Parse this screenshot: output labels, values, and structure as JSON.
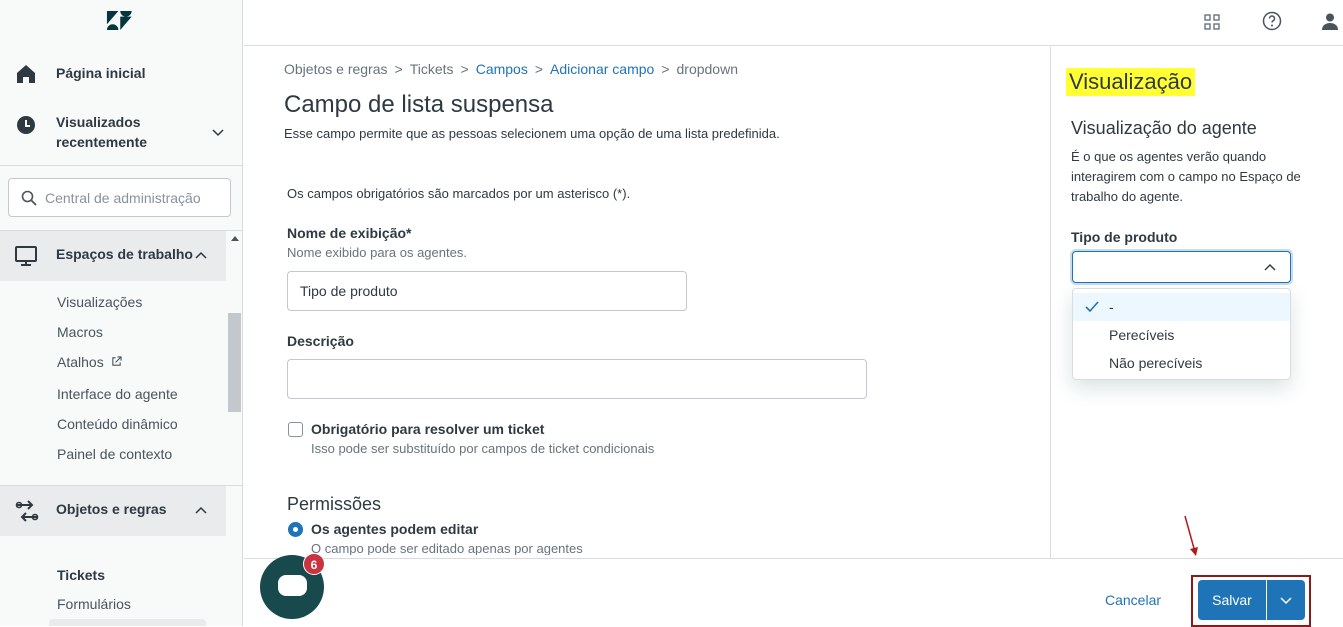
{
  "sidebar": {
    "nav": {
      "home": "Página inicial",
      "recent": "Visualizados recentemente",
      "workspaces": "Espaços de trabalho",
      "objects": "Objetos e regras"
    },
    "search_placeholder": "Central de administração",
    "workspaces_items": [
      "Visualizações",
      "Macros",
      "Atalhos",
      "Interface do agente",
      "Conteúdo dinâmico",
      "Painel de contexto"
    ],
    "objects_items": [
      "Tickets",
      "Formulários"
    ]
  },
  "breadcrumb": {
    "items": [
      "Objetos e regras",
      "Tickets",
      "Campos",
      "Adicionar campo",
      "dropdown"
    ],
    "separator": ">"
  },
  "page": {
    "title": "Campo de lista suspensa",
    "subtitle": "Esse campo permite que as pessoas selecionem uma opção de uma lista predefinida.",
    "required_note": "Os campos obrigatórios são marcados por um asterisco (*)."
  },
  "form": {
    "display_name_label": "Nome de exibição*",
    "display_name_hint": "Nome exibido para os agentes.",
    "display_name_value": "Tipo de produto",
    "description_label": "Descrição",
    "description_value": "",
    "required_checkbox_label": "Obrigatório para resolver um ticket",
    "required_checkbox_hint": "Isso pode ser substituído por campos de ticket condicionais",
    "required_checked": false,
    "permissions_heading": "Permissões",
    "permission_option_label": "Os agentes podem editar",
    "permission_option_hint": "O campo pode ser editado apenas por agentes",
    "permission_selected": true
  },
  "preview": {
    "title": "Visualização",
    "agent_heading": "Visualização do agente",
    "agent_desc": "É o que os agentes verão quando interagirem com o campo no Espaço de trabalho do agente.",
    "field_label": "Tipo de produto",
    "field_value": "",
    "options": [
      "-",
      "Perecíveis",
      "Não perecíveis"
    ],
    "selected_option": "-"
  },
  "footer": {
    "cancel_label": "Cancelar",
    "save_label": "Salvar"
  },
  "chat": {
    "badge_count": "6"
  },
  "colors": {
    "accent": "#1f73b7",
    "highlight": "#ffff33",
    "annotation": "#8b1a1a",
    "chat_bg": "#17494d",
    "badge": "#cc3340"
  }
}
